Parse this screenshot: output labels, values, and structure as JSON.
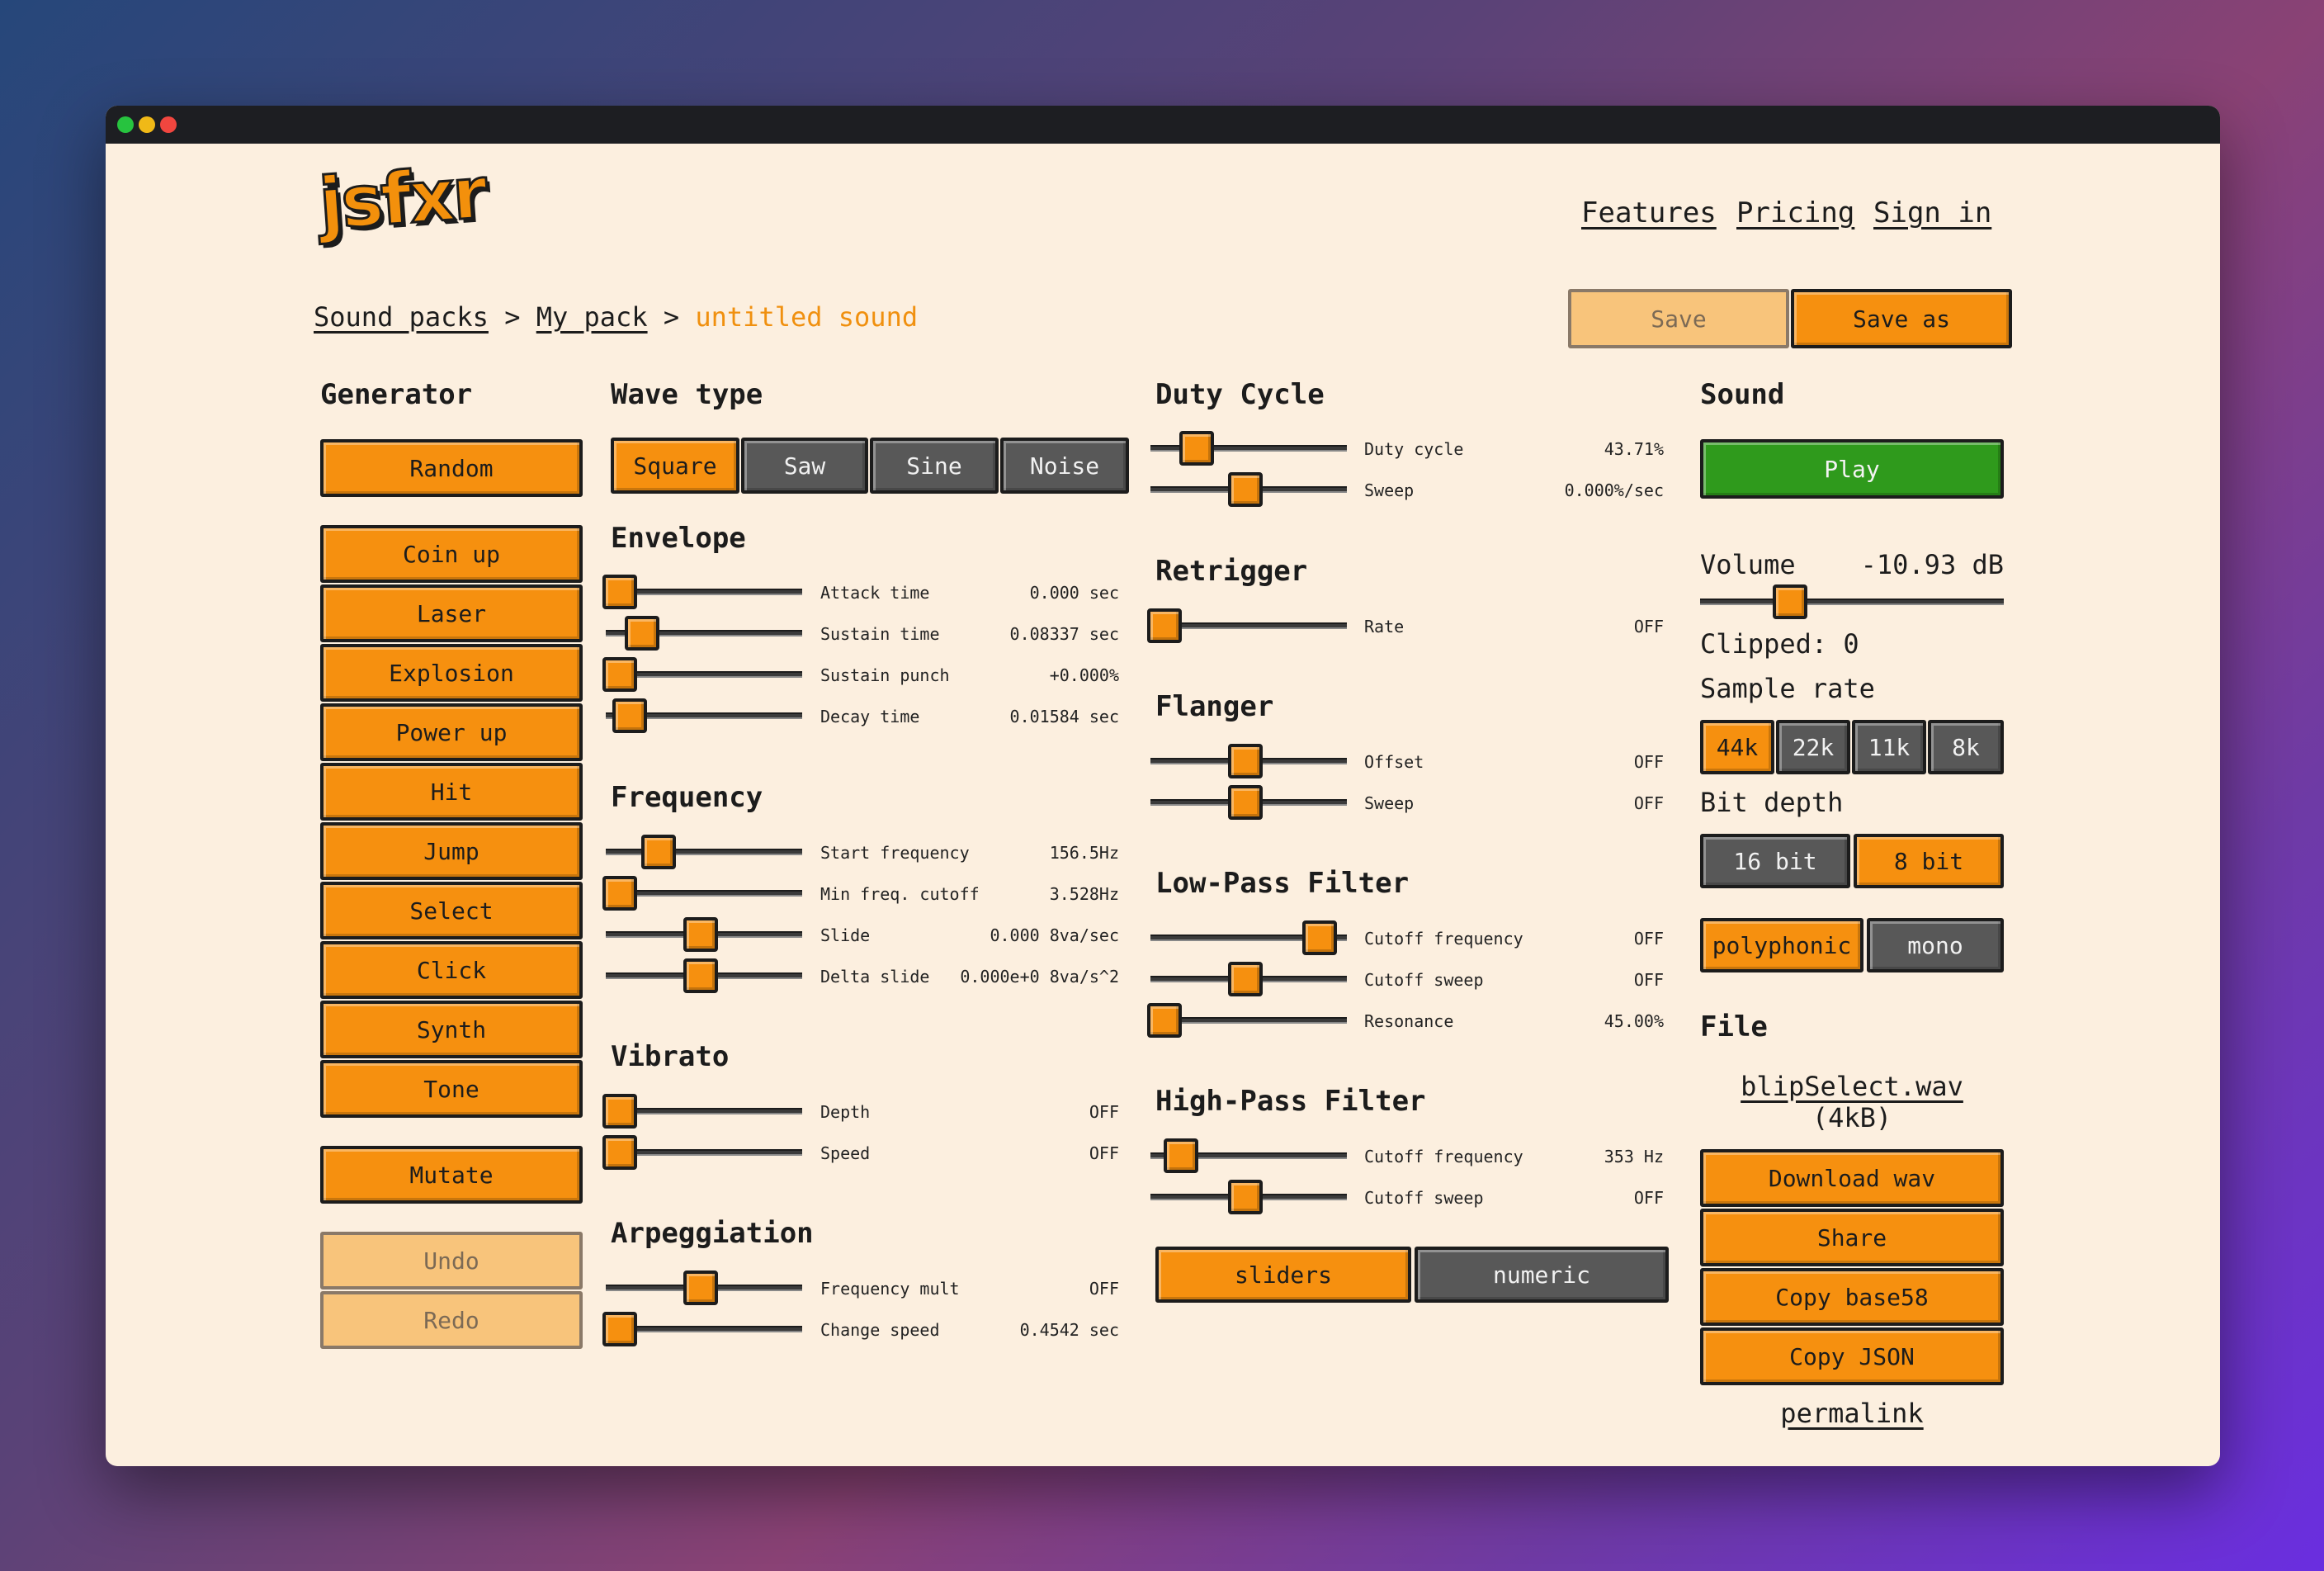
{
  "window": {
    "controls": [
      "close",
      "minimize",
      "maximize"
    ]
  },
  "logo": "jsfxr",
  "nav": {
    "features": "Features",
    "pricing": "Pricing",
    "sign_in": "Sign in"
  },
  "breadcrumb": {
    "root": "Sound packs",
    "sep": ">",
    "pack": "My pack",
    "current": "untitled sound"
  },
  "toolbar": {
    "save": "Save",
    "save_as": "Save as"
  },
  "generator": {
    "title": "Generator",
    "random": "Random",
    "presets": [
      "Coin up",
      "Laser",
      "Explosion",
      "Power up",
      "Hit",
      "Jump",
      "Select",
      "Click",
      "Synth",
      "Tone"
    ],
    "mutate": "Mutate",
    "undo": "Undo",
    "redo": "Redo"
  },
  "wave_type": {
    "title": "Wave type",
    "options": [
      "Square",
      "Saw",
      "Sine",
      "Noise"
    ],
    "selected": "Square"
  },
  "envelope": {
    "title": "Envelope",
    "params": [
      {
        "label": "Attack time",
        "value": "0.000 sec",
        "level": 0.0
      },
      {
        "label": "Sustain time",
        "value": "0.08337 sec",
        "level": 0.14
      },
      {
        "label": "Sustain punch",
        "value": "+0.000%",
        "level": 0.0
      },
      {
        "label": "Decay time",
        "value": "0.01584 sec",
        "level": 0.06
      }
    ]
  },
  "frequency": {
    "title": "Frequency",
    "params": [
      {
        "label": "Start frequency",
        "value": "156.5Hz",
        "level": 0.24
      },
      {
        "label": "Min freq. cutoff",
        "value": "3.528Hz",
        "level": 0.0
      },
      {
        "label": "Slide",
        "value": "0.000 8va/sec",
        "level": 0.5
      },
      {
        "label": "Delta slide",
        "value": "0.000e+0 8va/s^2",
        "level": 0.5
      }
    ]
  },
  "vibrato": {
    "title": "Vibrato",
    "params": [
      {
        "label": "Depth",
        "value": "OFF",
        "level": 0.0
      },
      {
        "label": "Speed",
        "value": "OFF",
        "level": 0.0
      }
    ]
  },
  "arpeggiation": {
    "title": "Arpeggiation",
    "params": [
      {
        "label": "Frequency mult",
        "value": "OFF",
        "level": 0.5
      },
      {
        "label": "Change speed",
        "value": "0.4542 sec",
        "level": 0.0
      }
    ]
  },
  "duty_cycle": {
    "title": "Duty Cycle",
    "params": [
      {
        "label": "Duty cycle",
        "value": "43.71%",
        "level": 0.2
      },
      {
        "label": "Sweep",
        "value": "0.000%/sec",
        "level": 0.5
      }
    ]
  },
  "retrigger": {
    "title": "Retrigger",
    "params": [
      {
        "label": "Rate",
        "value": "OFF",
        "level": 0.0
      }
    ]
  },
  "flanger": {
    "title": "Flanger",
    "params": [
      {
        "label": "Offset",
        "value": "OFF",
        "level": 0.5
      },
      {
        "label": "Sweep",
        "value": "OFF",
        "level": 0.5
      }
    ]
  },
  "low_pass": {
    "title": "Low-Pass Filter",
    "params": [
      {
        "label": "Cutoff frequency",
        "value": "OFF",
        "level": 0.96
      },
      {
        "label": "Cutoff sweep",
        "value": "OFF",
        "level": 0.5
      },
      {
        "label": "Resonance",
        "value": "45.00%",
        "level": 0.0
      }
    ]
  },
  "high_pass": {
    "title": "High-Pass Filter",
    "params": [
      {
        "label": "Cutoff frequency",
        "value": "353 Hz",
        "level": 0.1
      },
      {
        "label": "Cutoff sweep",
        "value": "OFF",
        "level": 0.5
      }
    ]
  },
  "view_mode": {
    "options": [
      "sliders",
      "numeric"
    ],
    "selected": "sliders"
  },
  "sound": {
    "title": "Sound",
    "play": "Play",
    "volume_label": "Volume",
    "volume_value": "-10.93 dB",
    "volume_level": 0.27,
    "clipped": "Clipped: 0",
    "sample_rate_label": "Sample rate",
    "sample_rates": [
      "44k",
      "22k",
      "11k",
      "8k"
    ],
    "sample_rate_selected": "44k",
    "bit_depth_label": "Bit depth",
    "bit_depths": [
      "16 bit",
      "8 bit"
    ],
    "bit_depth_selected": "8 bit",
    "modes": [
      "polyphonic",
      "mono"
    ],
    "mode_selected": "polyphonic"
  },
  "file": {
    "title": "File",
    "filename": "blipSelect.wav",
    "size": "(4kB)",
    "download": "Download wav",
    "share": "Share",
    "copy_b58": "Copy base58",
    "copy_json": "Copy JSON",
    "permalink": "permalink"
  },
  "colors": {
    "accent": "#f6900f",
    "panel": "#fcefdf",
    "dark_button": "#585858",
    "play": "#2f9a1c",
    "titlebar": "#1d1e22"
  }
}
